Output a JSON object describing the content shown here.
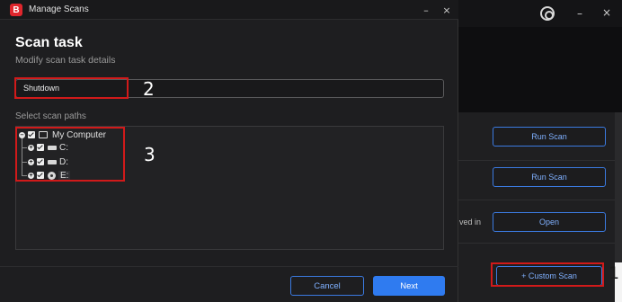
{
  "dialog": {
    "window_title": "Manage Scans",
    "logo_letter": "B",
    "heading": "Scan task",
    "subheading": "Modify scan task details",
    "task_name_value": "Shutdown",
    "paths_label": "Select scan paths",
    "tree": {
      "root": "My Computer",
      "children": [
        "C:",
        "D:",
        "E:"
      ]
    },
    "cancel_label": "Cancel",
    "next_label": "Next",
    "minimize_glyph": "–",
    "close_glyph": "×"
  },
  "background_app": {
    "run_scan_1": "Run Scan",
    "run_scan_2": "Run Scan",
    "partial_text": "ved in",
    "open_label": "Open",
    "custom_scan_label": "+ Custom Scan",
    "minimize_glyph": "–",
    "close_glyph": "×"
  },
  "annotations": {
    "step1": "1",
    "step2": "2",
    "step3": "3"
  },
  "colors": {
    "accent": "#2f7bf0",
    "annotation": "#d11a1a",
    "brand": "#e0262d"
  }
}
